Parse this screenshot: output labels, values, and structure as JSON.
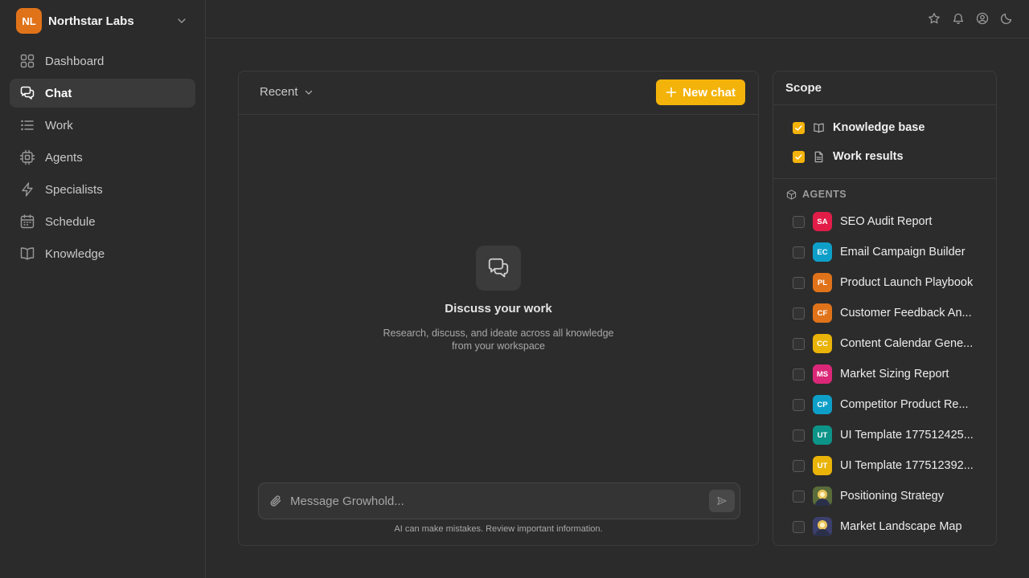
{
  "org": {
    "initials": "NL",
    "name": "Northstar Labs",
    "color": "#e0731a"
  },
  "nav": [
    {
      "label": "Dashboard",
      "icon": "grid-icon",
      "active": false
    },
    {
      "label": "Chat",
      "icon": "chat-icon",
      "active": true
    },
    {
      "label": "Work",
      "icon": "list-icon",
      "active": false
    },
    {
      "label": "Agents",
      "icon": "cpu-icon",
      "active": false
    },
    {
      "label": "Specialists",
      "icon": "lightning-icon",
      "active": false
    },
    {
      "label": "Schedule",
      "icon": "calendar-icon",
      "active": false
    },
    {
      "label": "Knowledge",
      "icon": "book-icon",
      "active": false
    }
  ],
  "topbar": {
    "icons": [
      "star-icon",
      "bell-icon",
      "user-icon",
      "moon-icon"
    ]
  },
  "chat": {
    "recent_label": "Recent",
    "new_chat_label": "New chat",
    "accent": "#f4b30a",
    "empty_title": "Discuss your work",
    "empty_desc": "Research, discuss, and ideate across all knowledge from your workspace",
    "input_placeholder": "Message Growhold...",
    "input_value": "",
    "disclaimer": "AI can make mistakes. Review important information."
  },
  "scope": {
    "title": "Scope",
    "sources": {
      "knowledge_base": {
        "label": "Knowledge base",
        "checked": true
      },
      "work_results": {
        "label": "Work results",
        "checked": true
      }
    },
    "agents_heading": "AGENTS",
    "agents": [
      {
        "initials": "SA",
        "name": "SEO Audit Report",
        "color": "#e11d48",
        "checked": false
      },
      {
        "initials": "EC",
        "name": "Email Campaign Builder",
        "color": "#0e9fc9",
        "checked": false
      },
      {
        "initials": "PL",
        "name": "Product Launch Playbook",
        "color": "#e0731a",
        "checked": false
      },
      {
        "initials": "CF",
        "name": "Customer Feedback An...",
        "color": "#e0731a",
        "checked": false
      },
      {
        "initials": "CC",
        "name": "Content Calendar Gene...",
        "color": "#eab308",
        "checked": false
      },
      {
        "initials": "MS",
        "name": "Market Sizing Report",
        "color": "#db2777",
        "checked": false
      },
      {
        "initials": "CP",
        "name": "Competitor Product Re...",
        "color": "#0e9fc9",
        "checked": false
      },
      {
        "initials": "UT",
        "name": "UI Template 177512425...",
        "color": "#0d9488",
        "checked": false
      },
      {
        "initials": "UT",
        "name": "UI Template 177512392...",
        "color": "#eab308",
        "checked": false
      },
      {
        "initials": "",
        "name": "Positioning Strategy",
        "color": "#5a6b3a",
        "checked": false,
        "image": true
      },
      {
        "initials": "",
        "name": "Market Landscape Map",
        "color": "#3b3f6b",
        "checked": false,
        "image": true
      }
    ]
  }
}
